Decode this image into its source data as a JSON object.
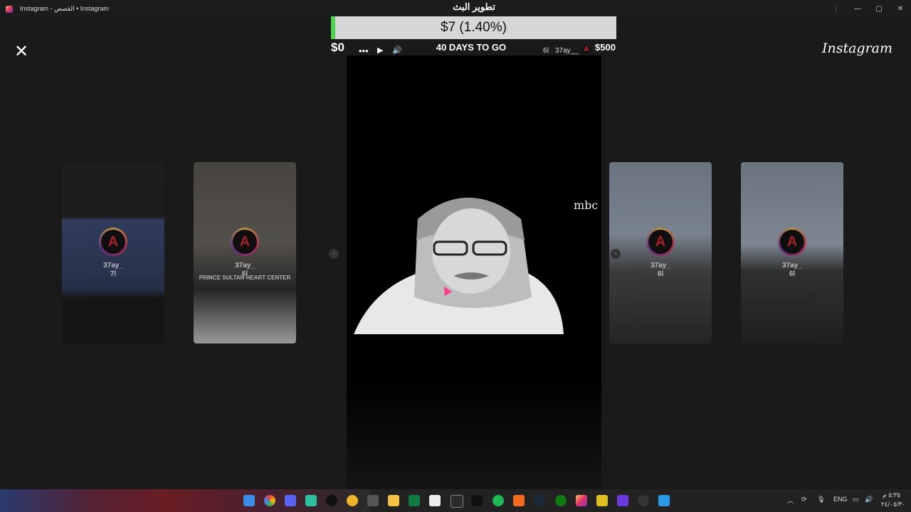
{
  "window": {
    "title": "Instagram - القصص • Instagram",
    "controls": [
      "⋮",
      "—",
      "▢",
      "✕"
    ]
  },
  "viewer": {
    "close_label": "✕",
    "logo": "Instagram"
  },
  "stream": {
    "title": "تطوير البث",
    "goal_text": "$7 (1.40%)",
    "goal_progress": 0.014,
    "goal_min": "$0",
    "goal_max": "$500",
    "days_left": "40 DAYS TO GO",
    "colors": {
      "fill": "#4cd64c",
      "track": "#d6d6d6"
    }
  },
  "main_story": {
    "username": "37ay__",
    "time": "6ا",
    "avatar_letter": "A",
    "controls": {
      "more": "•••",
      "play": "▶",
      "sound": "🔊"
    },
    "watermark": "mbc"
  },
  "side_stories": [
    {
      "username": "37ay_",
      "time": "7ا",
      "caption": "",
      "avatar_letter": "A"
    },
    {
      "username": "37ay_",
      "time": "6ا",
      "caption": "PRINCE SULTAN HEART CENTER",
      "avatar_letter": "A"
    },
    {
      "username": "37ay_",
      "time": "6ا",
      "caption": "",
      "avatar_letter": "A"
    },
    {
      "username": "37ay_",
      "time": "6ا",
      "caption": "",
      "avatar_letter": "A"
    }
  ],
  "taskbar": {
    "apps": [
      "windows-start",
      "chrome",
      "discord",
      "app-green",
      "github",
      "app-orange",
      "app-grey",
      "file-explorer",
      "app-white",
      "excel",
      "epic-games",
      "capcut",
      "spotify",
      "app-orange-2",
      "steam",
      "xbox",
      "instagram",
      "app-yellow",
      "app-purple",
      "app-g",
      "app-blue"
    ],
    "tray": {
      "language": "ENG",
      "time": "٥:٣٥ م",
      "date": "٢٤/٠٥/٣٠"
    }
  }
}
